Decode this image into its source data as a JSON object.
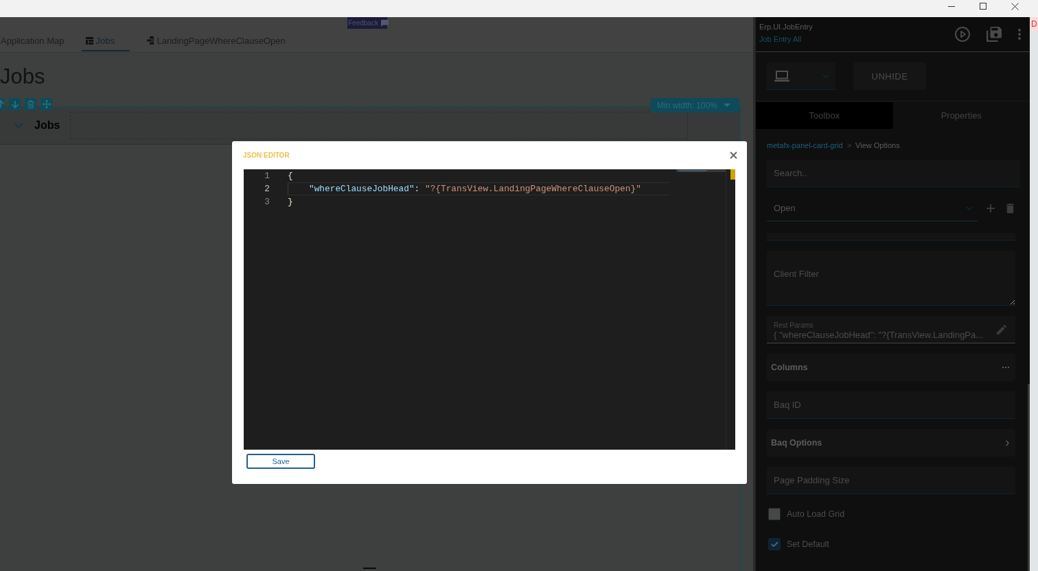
{
  "edge_label": "D",
  "tabs": [
    {
      "label": "Application Map",
      "kind": "plain",
      "selected": false
    },
    {
      "label": "Jobs",
      "kind": "grid",
      "selected": true
    },
    {
      "label": "LandingPageWhereClauseOpen",
      "kind": "view",
      "selected": false
    }
  ],
  "feedback": {
    "label": "Feedback"
  },
  "page": {
    "title": "Jobs",
    "min_width": "Min width: 100%",
    "card": {
      "title": "Jobs",
      "expanded": true
    }
  },
  "json_editor": {
    "title": "JSON EDITOR",
    "lines": [
      {
        "number": "1",
        "current": false,
        "indented": false,
        "tokens": [
          {
            "kind": "bracket",
            "text": "{"
          }
        ]
      },
      {
        "number": "2",
        "current": true,
        "indented": true,
        "tokens": [
          {
            "kind": "key",
            "text": "\"whereClauseJobHead\""
          },
          {
            "kind": "punct",
            "text": ": "
          },
          {
            "kind": "string",
            "text": "\"?{TransView.LandingPageWhereClauseOpen}\""
          }
        ]
      },
      {
        "number": "3",
        "current": false,
        "indented": false,
        "tokens": [
          {
            "kind": "bracket",
            "text": "}"
          }
        ]
      }
    ],
    "save_label": "Save"
  },
  "studio_panel": {
    "app_id": "Erp.UI.JobEntry",
    "layer": "Job Entry All",
    "unhide_label": "UNHIDE",
    "tabs": [
      {
        "label": "Toolbox",
        "selected": false
      },
      {
        "label": "Properties",
        "selected": true
      }
    ],
    "breadcrumb": {
      "items": [
        {
          "label": "metafx-panel-card-grid",
          "kind": "link"
        },
        {
          "label": "View Options",
          "kind": "current"
        }
      ],
      "separator": ">"
    },
    "search": {
      "placeholder": "Search.."
    },
    "view_select": {
      "value": "Open"
    },
    "properties": [
      {
        "kind": "strip"
      },
      {
        "kind": "textarea",
        "placeholder": "Client Filter"
      },
      {
        "kind": "param",
        "label": "Rest Params",
        "value": "{ \"whereClauseJobHead\": \"?{TransView.LandingPa..."
      },
      {
        "kind": "group",
        "label": "Columns"
      },
      {
        "kind": "field",
        "placeholder": "Baq ID"
      },
      {
        "kind": "nav",
        "label": "Baq Options"
      },
      {
        "kind": "field",
        "placeholder": "Page Padding Size"
      },
      {
        "kind": "checkbox",
        "label": "Auto Load Grid",
        "checked": false
      },
      {
        "kind": "checkbox",
        "label": "Set Default",
        "checked": true
      }
    ]
  }
}
